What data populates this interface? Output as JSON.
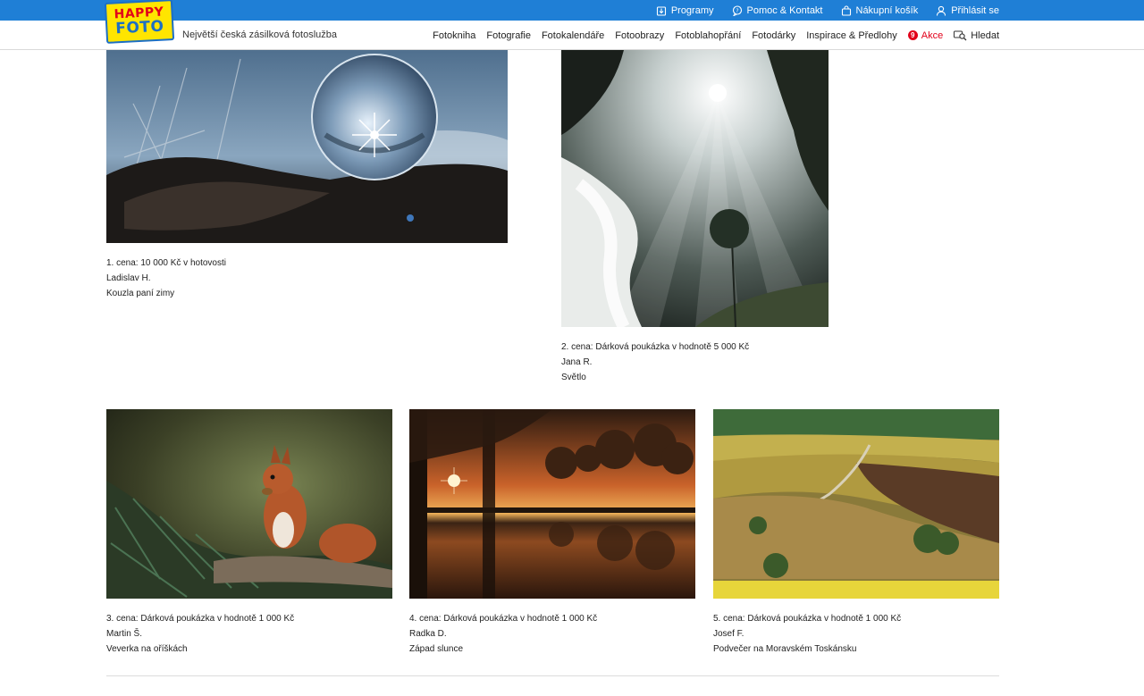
{
  "brand": {
    "logo_line1": "HAPPY",
    "logo_line2": "FOTO",
    "tagline": "Největší česká zásilková fotoslužba"
  },
  "topbar": {
    "programs": "Programy",
    "help": "Pomoc & Kontakt",
    "cart": "Nákupní košík",
    "login": "Přihlásit se"
  },
  "nav": {
    "items": [
      "Fotokniha",
      "Fotografie",
      "Fotokalendáře",
      "Fotoobrazy",
      "Fotoblahopřání",
      "Fotodárky",
      "Inspirace & Předlohy"
    ],
    "sale_badge": "9",
    "sale_label": "Akce",
    "search_label": "Hledat"
  },
  "winners": [
    {
      "prize": "1. cena: 10 000 Kč v hotovosti",
      "author": "Ladislav H.",
      "title": "Kouzla paní zimy"
    },
    {
      "prize": "2. cena: Dárková poukázka v hodnotě 5 000 Kč",
      "author": "Jana R.",
      "title": "Světlo"
    },
    {
      "prize": "3. cena: Dárková poukázka v hodnotě 1 000 Kč",
      "author": "Martin Š.",
      "title": "Veverka na oříškách"
    },
    {
      "prize": "4. cena: Dárková poukázka v hodnotě 1 000 Kč",
      "author": "Radka D.",
      "title": "Západ slunce"
    },
    {
      "prize": "5. cena: Dárková poukázka v hodnotě 1 000 Kč",
      "author": "Josef F.",
      "title": "Podvečer na Moravském Toskánsku"
    }
  ],
  "colors": {
    "topbar": "#1f7fd6",
    "logo_yellow": "#ffe500",
    "sale_red": "#e2001a"
  }
}
